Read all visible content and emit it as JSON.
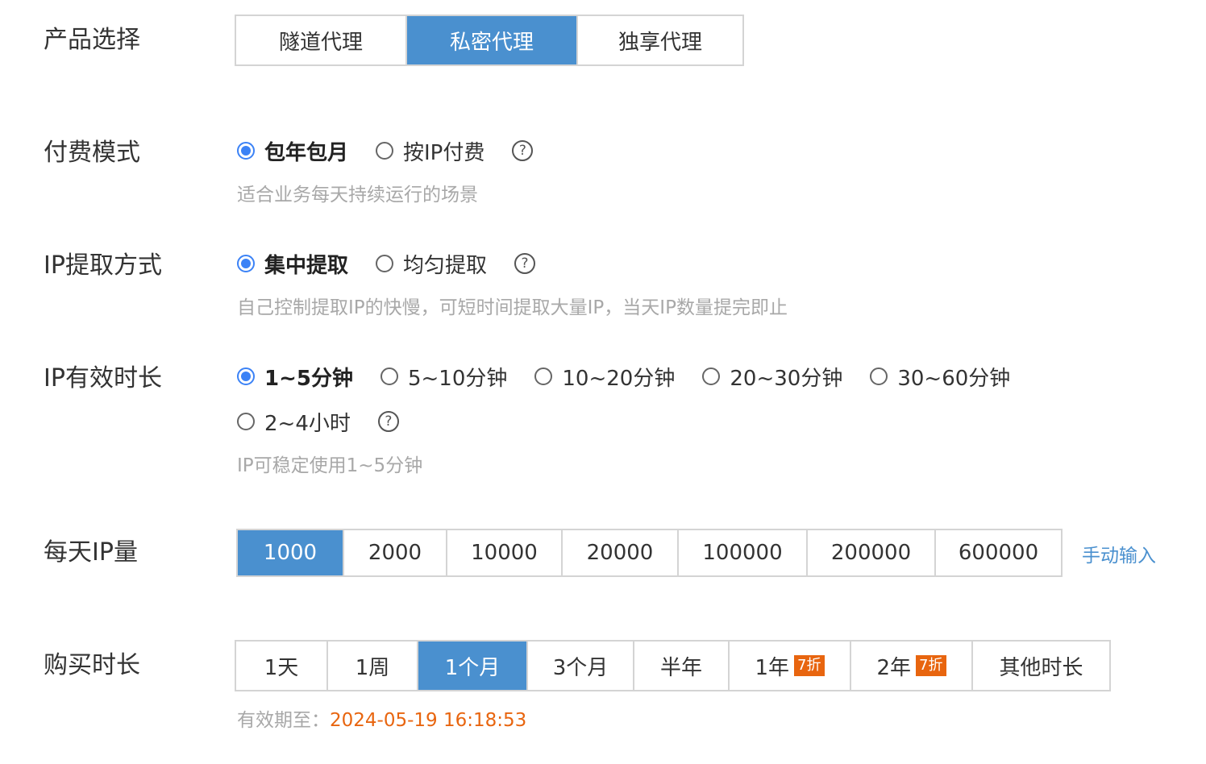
{
  "product": {
    "label": "产品选择",
    "options": [
      "隧道代理",
      "私密代理",
      "独享代理"
    ],
    "selected_index": 1
  },
  "billing": {
    "label": "付费模式",
    "options": [
      "包年包月",
      "按IP付费"
    ],
    "selected_index": 0,
    "hint": "适合业务每天持续运行的场景",
    "help_icon": "?"
  },
  "extract": {
    "label": "IP提取方式",
    "options": [
      "集中提取",
      "均匀提取"
    ],
    "selected_index": 0,
    "hint": "自己控制提取IP的快慢，可短时间提取大量IP，当天IP数量提完即止",
    "help_icon": "?"
  },
  "duration": {
    "label": "IP有效时长",
    "options": [
      "1~5分钟",
      "5~10分钟",
      "10~20分钟",
      "20~30分钟",
      "30~60分钟",
      "2~4小时"
    ],
    "selected_index": 0,
    "hint": "IP可稳定使用1~5分钟",
    "help_icon": "?"
  },
  "daily_ip": {
    "label": "每天IP量",
    "options": [
      "1000",
      "2000",
      "10000",
      "20000",
      "100000",
      "200000",
      "600000"
    ],
    "selected_index": 0,
    "manual_link": "手动输入"
  },
  "purchase": {
    "label": "购买时长",
    "options": [
      {
        "text": "1天",
        "badge": ""
      },
      {
        "text": "1周",
        "badge": ""
      },
      {
        "text": "1个月",
        "badge": ""
      },
      {
        "text": "3个月",
        "badge": ""
      },
      {
        "text": "半年",
        "badge": ""
      },
      {
        "text": "1年",
        "badge": "7折"
      },
      {
        "text": "2年",
        "badge": "7折"
      },
      {
        "text": "其他时长",
        "badge": ""
      }
    ],
    "selected_index": 2,
    "expiry_label": "有效期至：",
    "expiry_value": "2024-05-19 16:18:53"
  },
  "colors": {
    "accent": "#4a90cf",
    "radio_checked": "#3b82f6",
    "badge": "#e8650f",
    "hint_text": "#a8a8a8"
  }
}
